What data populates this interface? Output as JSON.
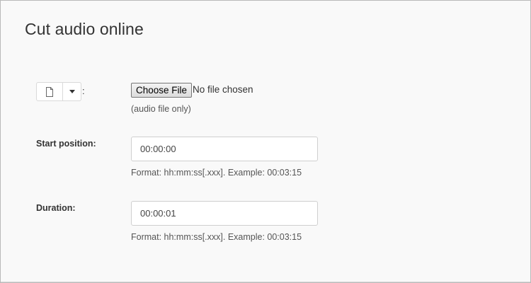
{
  "page": {
    "title": "Cut audio online"
  },
  "source": {
    "separator": ":",
    "choose_button_label": "Choose File",
    "no_file_text": "No file chosen",
    "hint": "(audio file only)"
  },
  "start": {
    "label": "Start position:",
    "value": "00:00:00",
    "format_hint": "Format: hh:mm:ss[.xxx]. Example: 00:03:15"
  },
  "duration": {
    "label": "Duration:",
    "value": "00:00:01",
    "format_hint": "Format: hh:mm:ss[.xxx]. Example: 00:03:15"
  },
  "icons": {
    "file": "file-icon",
    "dropdown": "caret-down-icon"
  }
}
